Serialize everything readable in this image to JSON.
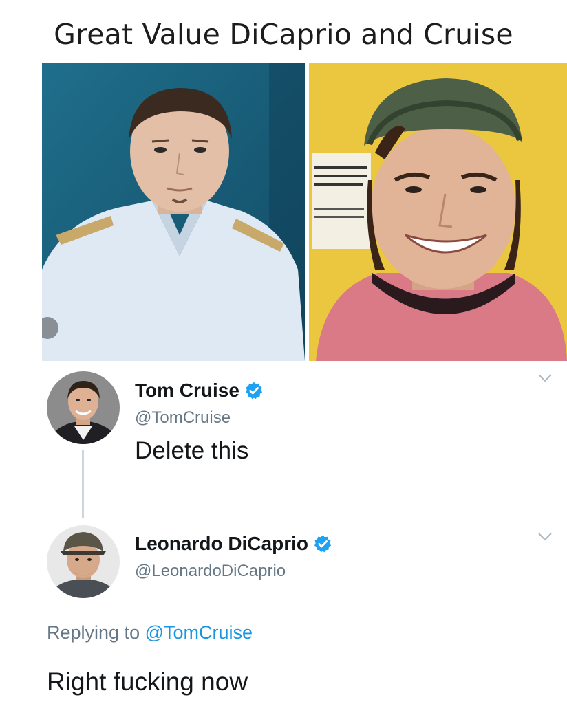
{
  "meme": {
    "title": "Great Value DiCaprio and Cruise"
  },
  "icons": {
    "verified": "verified-badge-icon",
    "more": "chevron-down-icon"
  },
  "colors": {
    "verified_blue": "#1da1f2",
    "mention_blue": "#1b95e0",
    "secondary_text": "#657786",
    "primary_text": "#14171a"
  },
  "tweets": [
    {
      "display_name": "Tom Cruise",
      "handle": "@TomCruise",
      "text": "Delete this",
      "verified": true
    },
    {
      "display_name": "Leonardo DiCaprio",
      "handle": "@LeonardoDiCaprio",
      "replying_label": "Replying to",
      "replying_to": "@TomCruise",
      "text": "Right fucking now",
      "verified": true
    }
  ]
}
